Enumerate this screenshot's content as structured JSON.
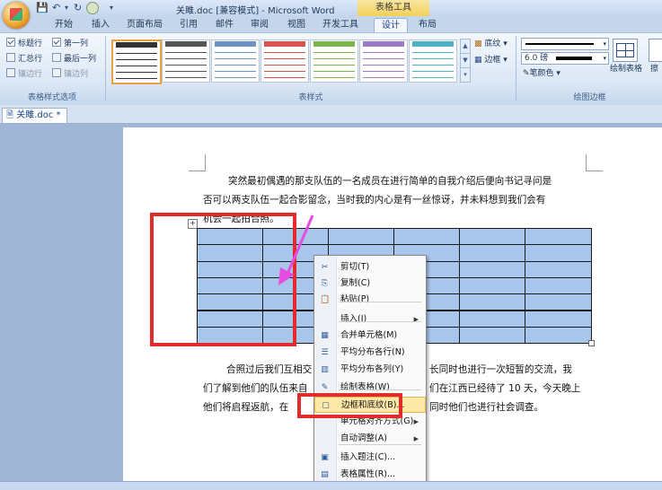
{
  "title_bar": {
    "doc_title": "关雎.doc [兼容模式] - Microsoft Word",
    "contextual_tab_group": "表格工具"
  },
  "tabs": [
    "开始",
    "插入",
    "页面布局",
    "引用",
    "邮件",
    "审阅",
    "视图",
    "开发工具",
    "设计",
    "布局"
  ],
  "active_tab": "设计",
  "ribbon": {
    "table_style_options": {
      "header_row": "标题行",
      "first_column": "第一列",
      "total_row": "汇总行",
      "last_column": "最后一列",
      "banded_rows": "镶边行",
      "banded_columns": "镶边列",
      "group_label": "表格样式选项"
    },
    "table_styles": {
      "shading": "底纹",
      "borders": "边框",
      "group_label": "表样式"
    },
    "draw_borders": {
      "pen_weight": "6.0 磅",
      "pen_color": "笔颜色",
      "draw_table": "绘制表格",
      "eraser_partial": "擦",
      "group_label": "绘图边框"
    }
  },
  "doc_tab": "关雎.doc *",
  "document": {
    "para1_line1": "突然最初偶遇的那支队伍的一名成员在进行简单的自我介绍后便向书记寻问是",
    "para1_line2": "否可以两支队伍一起合影留念，当时我的内心是有一丝惊讶，并未料想到我们会有",
    "para1_line3": "机会一起拍合照。",
    "para2_line1a": "合照过后我们互相交",
    "para2_line1b": "长同时也进行一次短暂的交流，我",
    "para2_line2a": "们了解到他们的队伍来自",
    "para2_line2b": "们在江西已经待了 10 天，今天晚上",
    "para2_line3a": "他们将启程返航，在",
    "para2_line3b": "同时他们也进行社会调查。"
  },
  "table": {
    "rows": 7,
    "cols": 6
  },
  "context_menu": [
    {
      "label": "剪切(T)",
      "icon": "scissors-icon",
      "submenu": false
    },
    {
      "label": "复制(C)",
      "icon": "copy-icon",
      "submenu": false
    },
    {
      "label": "粘贴(P)",
      "icon": "paste-icon",
      "submenu": false
    },
    {
      "label": "插入(I)",
      "icon": "",
      "submenu": true
    },
    {
      "label": "合并单元格(M)",
      "icon": "merge-cells-icon",
      "submenu": false
    },
    {
      "label": "平均分布各行(N)",
      "icon": "distribute-rows-icon",
      "submenu": false
    },
    {
      "label": "平均分布各列(Y)",
      "icon": "distribute-columns-icon",
      "submenu": false
    },
    {
      "label": "绘制表格(W)",
      "icon": "draw-table-icon",
      "submenu": false
    },
    {
      "label": "边框和底纹(B)...",
      "icon": "borders-shading-icon",
      "submenu": false
    },
    {
      "label": "单元格对齐方式(G)",
      "icon": "",
      "submenu": true
    },
    {
      "label": "自动调整(A)",
      "icon": "",
      "submenu": true
    },
    {
      "label": "插入题注(C)...",
      "icon": "caption-icon",
      "submenu": false
    },
    {
      "label": "表格属性(R)...",
      "icon": "table-properties-icon",
      "submenu": false
    }
  ],
  "highlight_color": "#e22b2b",
  "accent_color": "#f2cf5a"
}
